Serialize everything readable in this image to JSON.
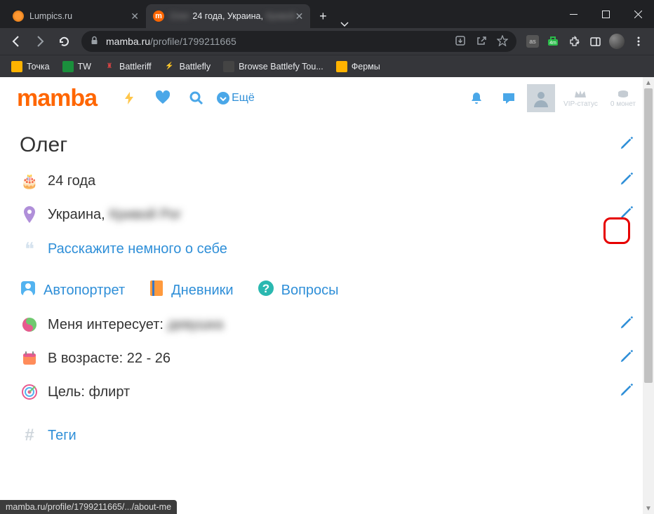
{
  "browser": {
    "tabs": [
      {
        "title": "Lumpics.ru",
        "active": false
      },
      {
        "title": "24 года, Украина,",
        "active": true
      }
    ],
    "url_domain": "mamba.ru",
    "url_path": "/profile/1799211665",
    "bookmarks": [
      "Точка",
      "TW",
      "Battleriff",
      "Battlefly",
      "Browse Battlefy Tou...",
      "Фермы"
    ],
    "status": "mamba.ru/profile/1799211665/.../about-me"
  },
  "header": {
    "logo": "mamba",
    "more": "Ещё",
    "vip": "VIP-статус",
    "coins": "0 монет"
  },
  "profile": {
    "name": "Олег",
    "age_text": "24 года",
    "location_prefix": "Украина,",
    "location_blur": "Кривой Рог",
    "about_prompt": "Расскажите немного о себе",
    "tabs": {
      "selfportrait": "Автопортрет",
      "diaries": "Дневники",
      "questions": "Вопросы"
    },
    "interest_label": "Меня интересует:",
    "interest_blur": "девушка",
    "age_range": "В возрасте: 22 - 26",
    "goal": "Цель: флирт",
    "tags": "Теги"
  }
}
